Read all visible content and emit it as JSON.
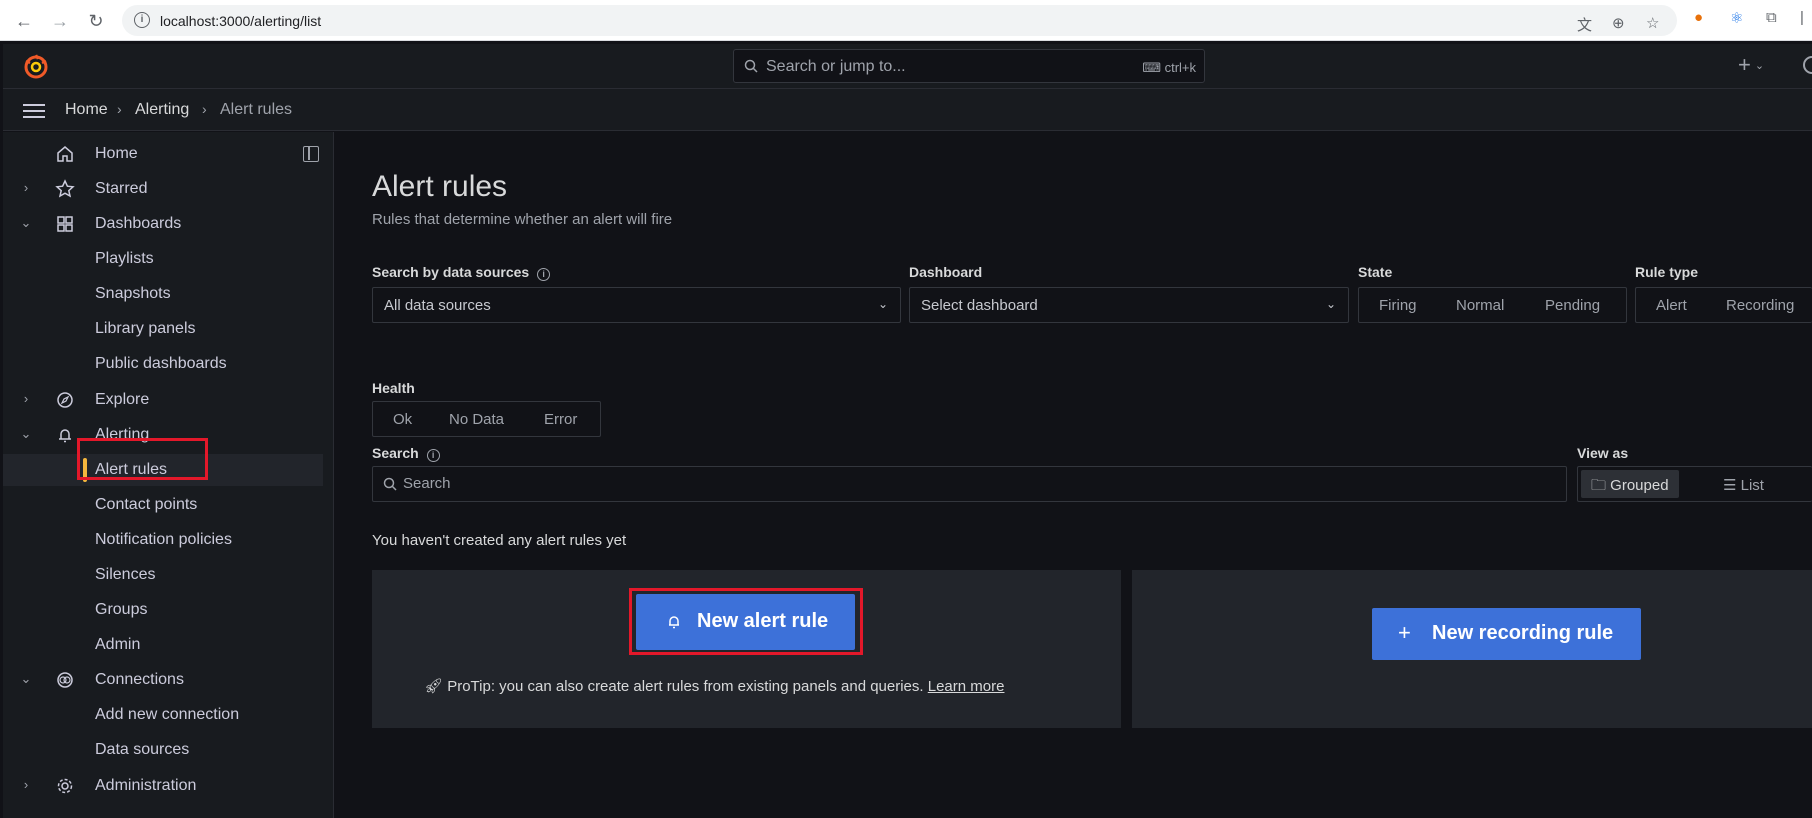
{
  "browser": {
    "url": "localhost:3000/alerting/list"
  },
  "topbar": {
    "search_placeholder": "Search or jump to...",
    "shortcut": "ctrl+k"
  },
  "breadcrumb": {
    "items": [
      "Home",
      "Alerting",
      "Alert rules"
    ]
  },
  "sidebar": {
    "items": [
      {
        "label": "Home",
        "icon": "home-icon"
      },
      {
        "label": "Starred",
        "icon": "star-icon"
      },
      {
        "label": "Dashboards",
        "icon": "apps-icon"
      },
      {
        "label": "Playlists"
      },
      {
        "label": "Snapshots"
      },
      {
        "label": "Library panels"
      },
      {
        "label": "Public dashboards"
      },
      {
        "label": "Explore",
        "icon": "compass-icon"
      },
      {
        "label": "Alerting",
        "icon": "bell-icon"
      },
      {
        "label": "Alert rules"
      },
      {
        "label": "Contact points"
      },
      {
        "label": "Notification policies"
      },
      {
        "label": "Silences"
      },
      {
        "label": "Groups"
      },
      {
        "label": "Admin"
      },
      {
        "label": "Connections",
        "icon": "connections-icon"
      },
      {
        "label": "Add new connection"
      },
      {
        "label": "Data sources"
      },
      {
        "label": "Administration",
        "icon": "cog-icon"
      }
    ]
  },
  "main": {
    "title": "Alert rules",
    "subtitle": "Rules that determine whether an alert will fire",
    "filters": {
      "datasource_label": "Search by data sources",
      "datasource_value": "All data sources",
      "dashboard_label": "Dashboard",
      "dashboard_value": "Select dashboard",
      "state_label": "State",
      "state_options": [
        "Firing",
        "Normal",
        "Pending"
      ],
      "ruletype_label": "Rule type",
      "ruletype_options": [
        "Alert",
        "Recording"
      ],
      "health_label": "Health",
      "health_options": [
        "Ok",
        "No Data",
        "Error"
      ],
      "search_label": "Search",
      "search_placeholder": "Search",
      "viewas_label": "View as",
      "viewas_options": [
        "Grouped",
        "List"
      ]
    },
    "empty_text": "You haven't created any alert rules yet",
    "new_alert_label": "New alert rule",
    "protip_text": "ProTip: you can also create alert rules from existing panels and queries.",
    "learn_more": "Learn more",
    "new_recording_label": "New recording rule"
  },
  "colors": {
    "accent": "#3d71d9",
    "active_bar": "#f5b73d",
    "highlight": "#e3182a"
  }
}
